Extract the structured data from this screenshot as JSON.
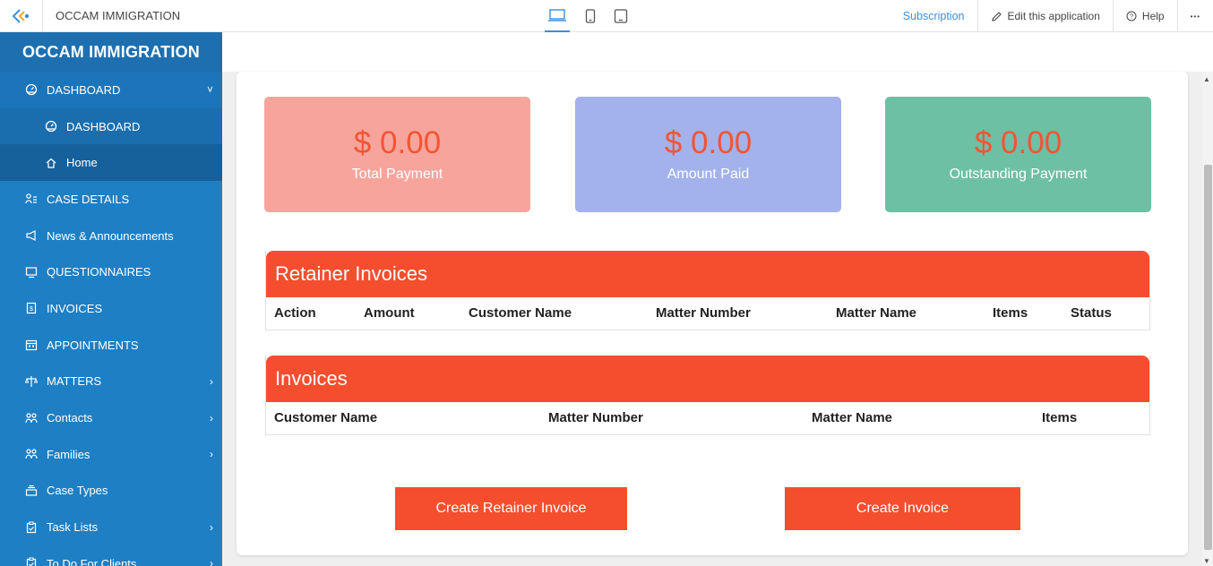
{
  "topbar": {
    "app_name": "OCCAM IMMIGRATION",
    "subscription": "Subscription",
    "edit": "Edit this application",
    "help": "Help",
    "more": "•••"
  },
  "sidebar": {
    "title": "OCCAM IMMIGRATION",
    "items": [
      {
        "label": "DASHBOARD",
        "icon": "dashboard-icon",
        "chevron": "˅"
      },
      {
        "label": "DASHBOARD",
        "icon": "dashboard-icon"
      },
      {
        "label": "Home",
        "icon": "home-icon"
      },
      {
        "label": "CASE DETAILS",
        "icon": "case-details-icon"
      },
      {
        "label": "News & Announcements",
        "icon": "megaphone-icon"
      },
      {
        "label": "QUESTIONNAIRES",
        "icon": "monitor-icon"
      },
      {
        "label": "INVOICES",
        "icon": "invoice-icon"
      },
      {
        "label": "APPOINTMENTS",
        "icon": "calendar-icon"
      },
      {
        "label": "MATTERS",
        "icon": "matters-icon",
        "chevron": "›"
      },
      {
        "label": "Contacts",
        "icon": "contacts-icon",
        "chevron": "›"
      },
      {
        "label": "Families",
        "icon": "families-icon",
        "chevron": "›"
      },
      {
        "label": "Case Types",
        "icon": "case-types-icon"
      },
      {
        "label": "Task Lists",
        "icon": "clipboard-icon",
        "chevron": "›"
      },
      {
        "label": "To Do For Clients",
        "icon": "clipboard-icon",
        "chevron": "›"
      }
    ]
  },
  "cards": [
    {
      "amount": "$ 0.00",
      "label": "Total Payment",
      "color": "#f7a59c"
    },
    {
      "amount": "$ 0.00",
      "label": "Amount Paid",
      "color": "#a3b2eb"
    },
    {
      "amount": "$ 0.00",
      "label": "Outstanding Payment",
      "color": "#6dc0a3"
    }
  ],
  "retainer_invoices": {
    "title": "Retainer Invoices",
    "columns": [
      "Action",
      "Amount",
      "Customer Name",
      "Matter Number",
      "Matter Name",
      "Items",
      "Status"
    ]
  },
  "invoices": {
    "title": "Invoices",
    "columns": [
      "Customer Name",
      "Matter Number",
      "Matter Name",
      "Items"
    ]
  },
  "buttons": {
    "create_retainer": "Create Retainer Invoice",
    "create_invoice": "Create Invoice"
  },
  "colors": {
    "sidebar": "#1e7fc4",
    "accent": "#f54e2f",
    "link": "#3b8fd9"
  }
}
